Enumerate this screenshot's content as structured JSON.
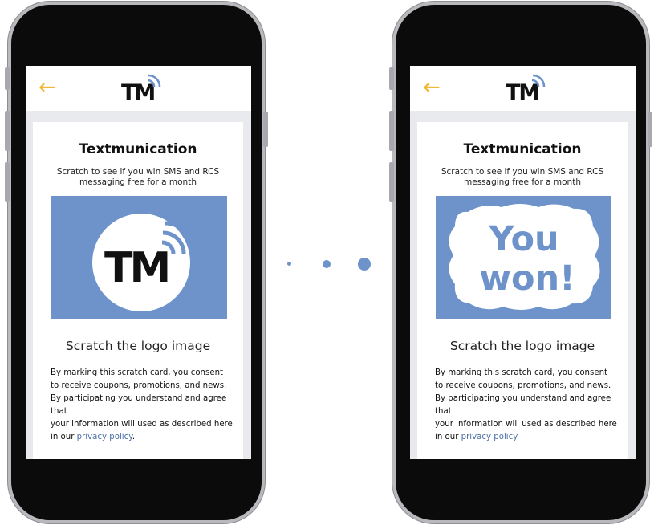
{
  "brand": {
    "logo_text": "TM"
  },
  "colors": {
    "accent_arrow": "#f2b632",
    "scratch_blue": "#6e93cb",
    "link": "#4a6fa5"
  },
  "appbar": {
    "back_icon": "arrow-left-icon",
    "back_glyph": "←"
  },
  "card": {
    "title": "Textmunication",
    "subtitle": "Scratch to see if you win SMS and RCS messaging free for a month",
    "instruction": "Scratch the logo image",
    "consent_lines": [
      "By marking this scratch card, you consent",
      "to receive coupons, promotions, and news.",
      "By participating you understand and agree that",
      "your information will used as described here"
    ],
    "consent_tail_prefix": "in our ",
    "privacy_link": "privacy policy",
    "consent_tail_suffix": "."
  },
  "prize": {
    "line1": "You",
    "line2": "won!"
  }
}
